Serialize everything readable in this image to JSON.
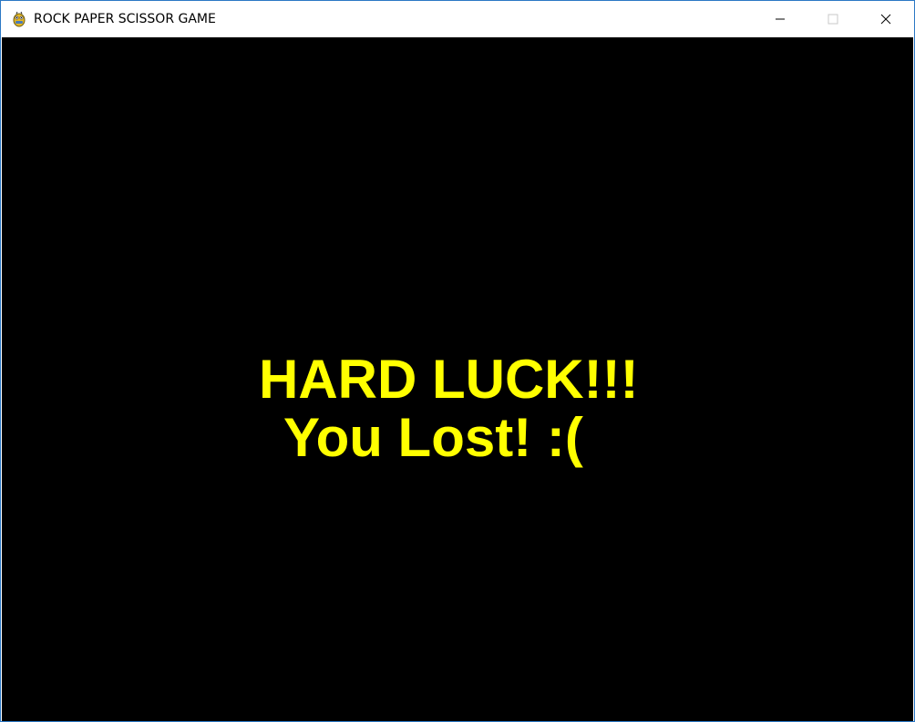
{
  "window": {
    "title": "ROCK PAPER SCISSOR GAME",
    "app_icon": "pygame-snake-icon",
    "controls": {
      "minimize_icon": "minimize-icon",
      "maximize_icon": "maximize-icon",
      "close_icon": "close-icon"
    }
  },
  "game": {
    "background_color": "#000000",
    "text_color": "#ffff00",
    "message_line1": "HARD LUCK!!!",
    "message_line2": "You Lost! :("
  }
}
